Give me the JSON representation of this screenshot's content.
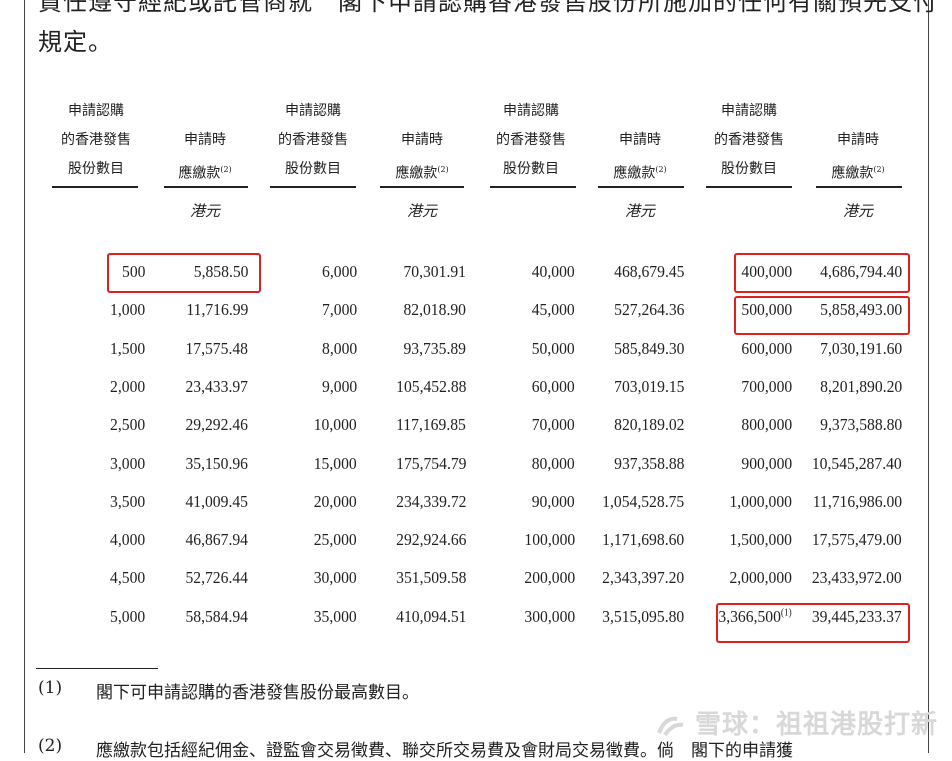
{
  "intro": {
    "line1": "責任遵守經紀或託管商就　閣下申請認購香港發售股份所施加的任何有關預先支付",
    "line2": "規定。"
  },
  "header": {
    "shares_label": [
      "申請認購",
      "的香港發售",
      "股份數目"
    ],
    "payment_label": [
      "申請時",
      "應繳款"
    ],
    "payment_note": "(2)",
    "unit": "港元"
  },
  "table": [
    [
      {
        "s": "500",
        "p": "5,858.50"
      },
      {
        "s": "1,000",
        "p": "11,716.99"
      },
      {
        "s": "1,500",
        "p": "17,575.48"
      },
      {
        "s": "2,000",
        "p": "23,433.97"
      },
      {
        "s": "2,500",
        "p": "29,292.46"
      },
      {
        "s": "3,000",
        "p": "35,150.96"
      },
      {
        "s": "3,500",
        "p": "41,009.45"
      },
      {
        "s": "4,000",
        "p": "46,867.94"
      },
      {
        "s": "4,500",
        "p": "52,726.44"
      },
      {
        "s": "5,000",
        "p": "58,584.94"
      }
    ],
    [
      {
        "s": "6,000",
        "p": "70,301.91"
      },
      {
        "s": "7,000",
        "p": "82,018.90"
      },
      {
        "s": "8,000",
        "p": "93,735.89"
      },
      {
        "s": "9,000",
        "p": "105,452.88"
      },
      {
        "s": "10,000",
        "p": "117,169.85"
      },
      {
        "s": "15,000",
        "p": "175,754.79"
      },
      {
        "s": "20,000",
        "p": "234,339.72"
      },
      {
        "s": "25,000",
        "p": "292,924.66"
      },
      {
        "s": "30,000",
        "p": "351,509.58"
      },
      {
        "s": "35,000",
        "p": "410,094.51"
      }
    ],
    [
      {
        "s": "40,000",
        "p": "468,679.45"
      },
      {
        "s": "45,000",
        "p": "527,264.36"
      },
      {
        "s": "50,000",
        "p": "585,849.30"
      },
      {
        "s": "60,000",
        "p": "703,019.15"
      },
      {
        "s": "70,000",
        "p": "820,189.02"
      },
      {
        "s": "80,000",
        "p": "937,358.88"
      },
      {
        "s": "90,000",
        "p": "1,054,528.75"
      },
      {
        "s": "100,000",
        "p": "1,171,698.60"
      },
      {
        "s": "200,000",
        "p": "2,343,397.20"
      },
      {
        "s": "300,000",
        "p": "3,515,095.80"
      }
    ],
    [
      {
        "s": "400,000",
        "p": "4,686,794.40"
      },
      {
        "s": "500,000",
        "p": "5,858,493.00"
      },
      {
        "s": "600,000",
        "p": "7,030,191.60"
      },
      {
        "s": "700,000",
        "p": "8,201,890.20"
      },
      {
        "s": "800,000",
        "p": "9,373,588.80"
      },
      {
        "s": "900,000",
        "p": "10,545,287.40"
      },
      {
        "s": "1,000,000",
        "p": "11,716,986.00"
      },
      {
        "s": "1,500,000",
        "p": "17,575,479.00"
      },
      {
        "s": "2,000,000",
        "p": "23,433,972.00"
      },
      {
        "s": "3,366,500",
        "p": "39,445,233.37",
        "note": "(1)"
      }
    ]
  ],
  "notes": [
    {
      "num": "(1)",
      "text": "閣下可申請認購的香港發售股份最高數目。"
    },
    {
      "num": "(2)",
      "text": "應繳款包括經紀佣金、證監會交易徵費、聯交所交易費及會財局交易徵費。倘　閣下的申請獲"
    }
  ],
  "watermark": "雪球：祖祖港股打新",
  "highlight_color": "#e02020"
}
